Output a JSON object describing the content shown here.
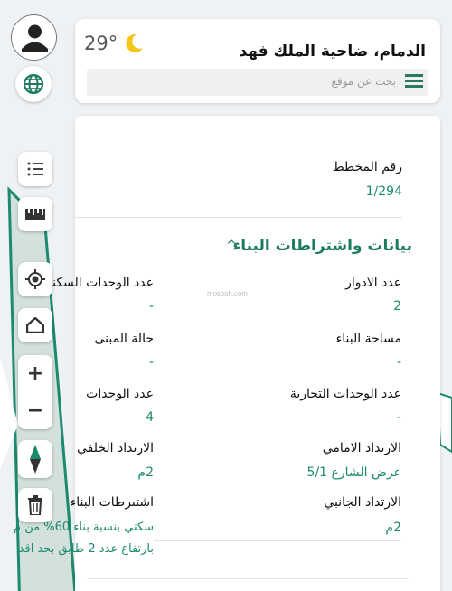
{
  "header": {
    "location": "الدمام، ضاحية الملك فهد",
    "temperature": "29°",
    "search_placeholder": "بحث عن موقع",
    "icons": {
      "weather": "moon-icon",
      "menu": "menu-icon"
    }
  },
  "controls": {
    "icons": [
      "user-icon",
      "globe-icon",
      "list-icon",
      "ruler-icon",
      "locate-icon",
      "home-icon",
      "zoom-in-icon",
      "zoom-out-icon",
      "compass-icon",
      "trash-icon"
    ],
    "zoom_in": "+",
    "zoom_out": "−"
  },
  "plan": {
    "label": "رقم المخطط",
    "value": "1/294"
  },
  "section": {
    "title": "بيانات واشتراطات البناء",
    "chevron": "^"
  },
  "watermark": "mosoah.com",
  "fields": {
    "floors_label": "عدد الادوار",
    "floors_value": "2",
    "residential_units_label": "عدد الوحدات السكنية",
    "residential_units_value": "-",
    "building_area_label": "مساحة البناء",
    "building_area_value": "-",
    "building_status_label": "حالة المبنى",
    "building_status_value": "-",
    "commercial_units_label": "عدد الوحدات التجارية",
    "commercial_units_value": "-",
    "units_label": "عدد الوحدات",
    "units_value": "4",
    "front_setback_label": "الارتداد الامامي",
    "front_setback_value": "عرض الشارع 5/1",
    "rear_setback_label": "الارتداد الخلفي",
    "rear_setback_value": "2م",
    "side_setback_label": "الارتداد الجانبي",
    "side_setback_value": "2م",
    "requirements_label": "اشتىرطات البناء",
    "requirements_line1": "سكني بنسبة بناء 60% من م",
    "requirements_line2": "بارتفاع عدد 2 طابق بحد اقد"
  },
  "colors": {
    "accent": "#1c8a6d",
    "brand": "#2c7a5e"
  }
}
